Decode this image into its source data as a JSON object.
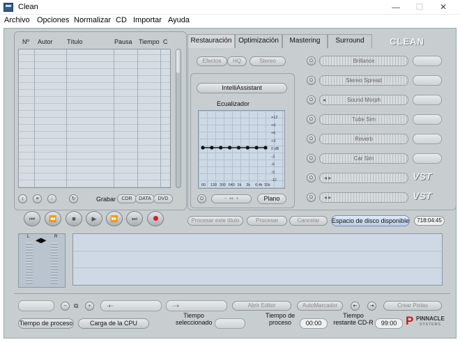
{
  "window": {
    "title": "Clean"
  },
  "menu": [
    "Archivo",
    "Opciones",
    "Normalizar",
    "CD",
    "Importar",
    "Ayuda"
  ],
  "playlist": {
    "columns": [
      "Nº",
      "Autor",
      "Título",
      "Pausa",
      "Tiempo",
      "C"
    ]
  },
  "record": {
    "label": "Grabar",
    "formats": [
      "CDR",
      "DATA",
      "DVD"
    ]
  },
  "tabs": [
    "Restauración",
    "Optimización",
    "Mastering",
    "Surround"
  ],
  "brand": "CLEAN",
  "restoration": {
    "mode_buttons": [
      "Efectos",
      "HQ",
      "Stereo"
    ],
    "intelli_button": "IntelliAssistant",
    "eq_title": "Ecualizador",
    "eq_db_labels": [
      "+12",
      "+9",
      "+6",
      "+3",
      "0 dB",
      "-3",
      "-6",
      "-9",
      "-12"
    ],
    "eq_freq_labels": [
      "60",
      "130",
      "300",
      "640",
      "1k",
      "3k",
      "6.4k",
      "15k"
    ],
    "eq_values_db": [
      0,
      0,
      0,
      0,
      0,
      0,
      0,
      0
    ],
    "eq_preset": "Plano"
  },
  "effects": [
    "Brillance",
    "Stereo Spread",
    "Sound Morph",
    "Tube Sim",
    "Reverb",
    "Car Sim"
  ],
  "vst_label": "VST",
  "process": {
    "buttons": [
      "Procesar este título",
      "Procesar",
      "Cancelar"
    ],
    "disk_label": "Espacio de disco disponible",
    "disk_time": "718:04:45"
  },
  "bottom": {
    "abrir_editor": "Abrir Editor",
    "automarcador": "AutoMarcador",
    "crear_pistas": "Crear Pistas",
    "tiempo_proceso_btn": "Tiempo de proceso",
    "carga_cpu_btn": "Carga de la CPU",
    "tiempo_seleccionado": "Tiempo seleccionado",
    "tiempo_de_proceso": "Tiempo de proceso",
    "tiempo_de_proceso_value": "00:00",
    "tiempo_restante": "Tiempo restante CD-R",
    "tiempo_restante_value": "99:00",
    "pinnacle_brand": "PINNACLE",
    "pinnacle_sub": "SYSTEMS"
  },
  "colors": {
    "app_bg": "#c8cdd0",
    "accent_blue": "#b9ccea",
    "record_red": "#e0142a"
  }
}
